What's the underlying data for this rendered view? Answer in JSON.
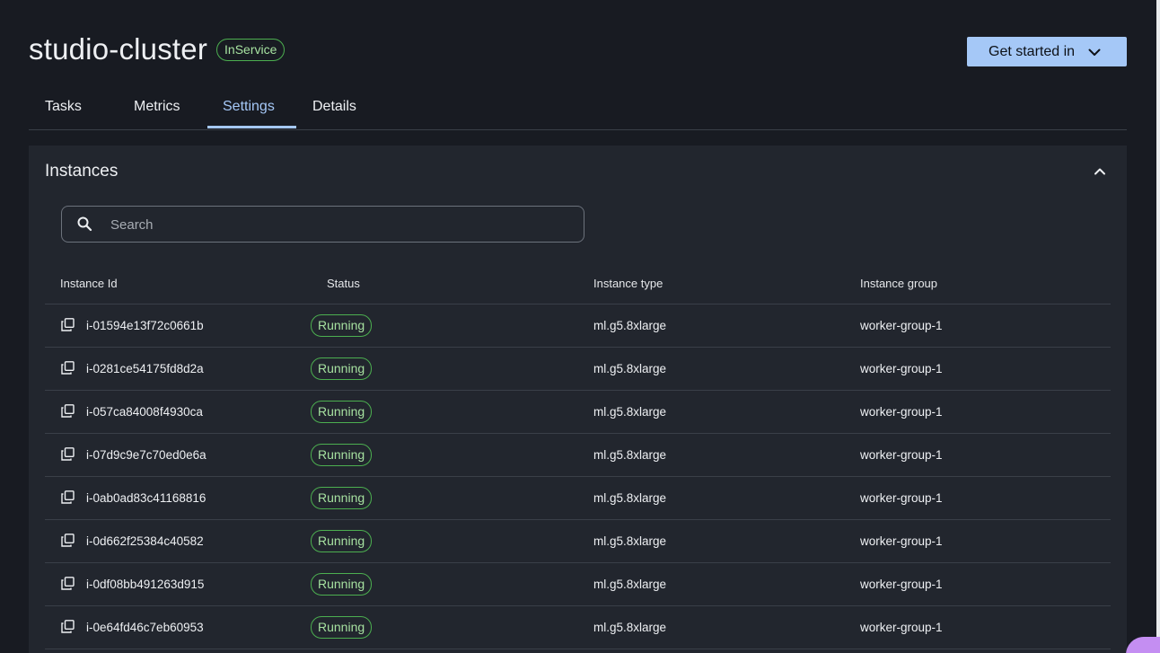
{
  "header": {
    "title": "studio-cluster",
    "status": "InService",
    "get_started_label": "Get started in"
  },
  "tabs": [
    {
      "label": "Tasks",
      "active": false
    },
    {
      "label": "Metrics",
      "active": false
    },
    {
      "label": "Settings",
      "active": true
    },
    {
      "label": "Details",
      "active": false
    }
  ],
  "instances": {
    "title": "Instances",
    "search_placeholder": "Search",
    "columns": [
      "Instance Id",
      "Status",
      "Instance type",
      "Instance group"
    ],
    "rows": [
      {
        "id": "i-01594e13f72c0661b",
        "status": "Running",
        "type": "ml.g5.8xlarge",
        "group": "worker-group-1"
      },
      {
        "id": "i-0281ce54175fd8d2a",
        "status": "Running",
        "type": "ml.g5.8xlarge",
        "group": "worker-group-1"
      },
      {
        "id": "i-057ca84008f4930ca",
        "status": "Running",
        "type": "ml.g5.8xlarge",
        "group": "worker-group-1"
      },
      {
        "id": "i-07d9c9e7c70ed0e6a",
        "status": "Running",
        "type": "ml.g5.8xlarge",
        "group": "worker-group-1"
      },
      {
        "id": "i-0ab0ad83c41168816",
        "status": "Running",
        "type": "ml.g5.8xlarge",
        "group": "worker-group-1"
      },
      {
        "id": "i-0d662f25384c40582",
        "status": "Running",
        "type": "ml.g5.8xlarge",
        "group": "worker-group-1"
      },
      {
        "id": "i-0df08bb491263d915",
        "status": "Running",
        "type": "ml.g5.8xlarge",
        "group": "worker-group-1"
      },
      {
        "id": "i-0e64fd46c7eb60953",
        "status": "Running",
        "type": "ml.g5.8xlarge",
        "group": "worker-group-1"
      }
    ]
  },
  "colors": {
    "background": "#181b22",
    "panel": "#22262e",
    "accent": "#a5c8f7",
    "status_green": "#4caf50",
    "status_text": "#a6e1a0"
  },
  "icons": {
    "search": "search-icon",
    "copy": "copy-icon",
    "collapse": "chevron-up-icon",
    "dropdown": "chevron-down-icon"
  }
}
